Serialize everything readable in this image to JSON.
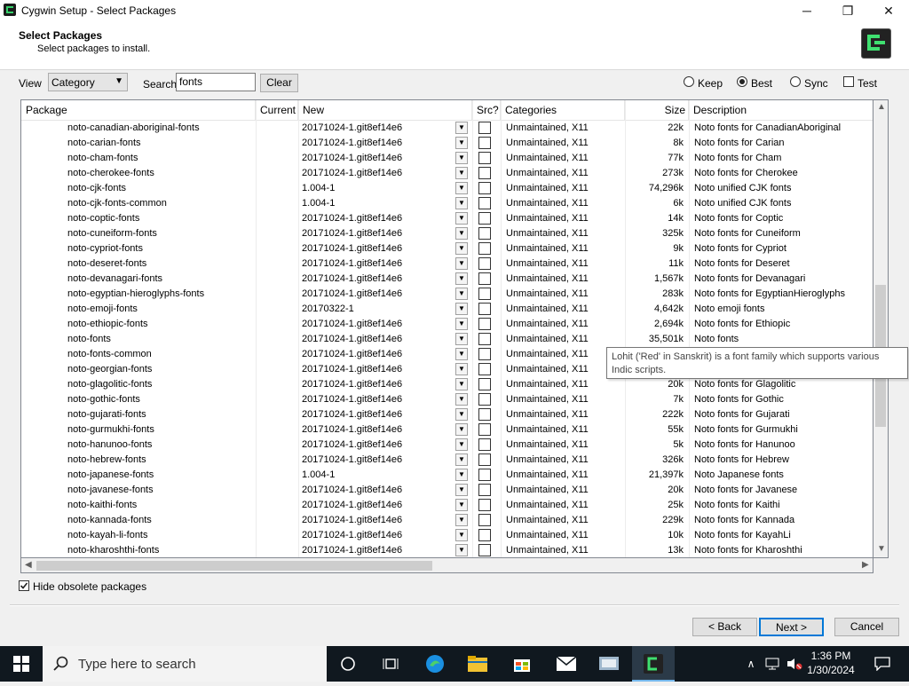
{
  "window": {
    "title": "Cygwin Setup - Select Packages",
    "minimize": "─",
    "maximize": "❐",
    "close": "✕"
  },
  "header": {
    "title": "Select Packages",
    "subtitle": "Select packages to install."
  },
  "toolbar": {
    "view_label": "View",
    "view_value": "Category",
    "search_label": "Search",
    "search_value": "fonts",
    "clear_label": "Clear",
    "radios": [
      {
        "label": "Keep",
        "selected": false
      },
      {
        "label": "Best",
        "selected": true
      },
      {
        "label": "Sync",
        "selected": false
      }
    ],
    "test_label": "Test"
  },
  "columns": [
    "Package",
    "Current",
    "New",
    "Src?",
    "Categories",
    "Size",
    "Description"
  ],
  "rows": [
    {
      "pkg": "noto-canadian-aboriginal-fonts",
      "new": "20171024-1.git8ef14e6",
      "cat": "Unmaintained, X11",
      "size": "22k",
      "desc": "Noto fonts for CanadianAboriginal"
    },
    {
      "pkg": "noto-carian-fonts",
      "new": "20171024-1.git8ef14e6",
      "cat": "Unmaintained, X11",
      "size": "8k",
      "desc": "Noto fonts for Carian"
    },
    {
      "pkg": "noto-cham-fonts",
      "new": "20171024-1.git8ef14e6",
      "cat": "Unmaintained, X11",
      "size": "77k",
      "desc": "Noto fonts for Cham"
    },
    {
      "pkg": "noto-cherokee-fonts",
      "new": "20171024-1.git8ef14e6",
      "cat": "Unmaintained, X11",
      "size": "273k",
      "desc": "Noto fonts for Cherokee"
    },
    {
      "pkg": "noto-cjk-fonts",
      "new": "1.004-1",
      "cat": "Unmaintained, X11",
      "size": "74,296k",
      "desc": "Noto unified CJK fonts"
    },
    {
      "pkg": "noto-cjk-fonts-common",
      "new": "1.004-1",
      "cat": "Unmaintained, X11",
      "size": "6k",
      "desc": "Noto unified CJK fonts"
    },
    {
      "pkg": "noto-coptic-fonts",
      "new": "20171024-1.git8ef14e6",
      "cat": "Unmaintained, X11",
      "size": "14k",
      "desc": "Noto fonts for Coptic"
    },
    {
      "pkg": "noto-cuneiform-fonts",
      "new": "20171024-1.git8ef14e6",
      "cat": "Unmaintained, X11",
      "size": "325k",
      "desc": "Noto fonts for Cuneiform"
    },
    {
      "pkg": "noto-cypriot-fonts",
      "new": "20171024-1.git8ef14e6",
      "cat": "Unmaintained, X11",
      "size": "9k",
      "desc": "Noto fonts for Cypriot"
    },
    {
      "pkg": "noto-deseret-fonts",
      "new": "20171024-1.git8ef14e6",
      "cat": "Unmaintained, X11",
      "size": "11k",
      "desc": "Noto fonts for Deseret"
    },
    {
      "pkg": "noto-devanagari-fonts",
      "new": "20171024-1.git8ef14e6",
      "cat": "Unmaintained, X11",
      "size": "1,567k",
      "desc": "Noto fonts for Devanagari"
    },
    {
      "pkg": "noto-egyptian-hieroglyphs-fonts",
      "new": "20171024-1.git8ef14e6",
      "cat": "Unmaintained, X11",
      "size": "283k",
      "desc": "Noto fonts for EgyptianHieroglyphs"
    },
    {
      "pkg": "noto-emoji-fonts",
      "new": "20170322-1",
      "cat": "Unmaintained, X11",
      "size": "4,642k",
      "desc": "Noto emoji fonts"
    },
    {
      "pkg": "noto-ethiopic-fonts",
      "new": "20171024-1.git8ef14e6",
      "cat": "Unmaintained, X11",
      "size": "2,694k",
      "desc": "Noto fonts for Ethiopic"
    },
    {
      "pkg": "noto-fonts",
      "new": "20171024-1.git8ef14e6",
      "cat": "Unmaintained, X11",
      "size": "35,501k",
      "desc": "Noto fonts"
    },
    {
      "pkg": "noto-fonts-common",
      "new": "20171024-1.git8ef14e6",
      "cat": "Unmaintained, X11",
      "size": "",
      "desc": ""
    },
    {
      "pkg": "noto-georgian-fonts",
      "new": "20171024-1.git8ef14e6",
      "cat": "Unmaintained, X11",
      "size": "",
      "desc": ""
    },
    {
      "pkg": "noto-glagolitic-fonts",
      "new": "20171024-1.git8ef14e6",
      "cat": "Unmaintained, X11",
      "size": "20k",
      "desc": "Noto fonts for Glagolitic"
    },
    {
      "pkg": "noto-gothic-fonts",
      "new": "20171024-1.git8ef14e6",
      "cat": "Unmaintained, X11",
      "size": "7k",
      "desc": "Noto fonts for Gothic"
    },
    {
      "pkg": "noto-gujarati-fonts",
      "new": "20171024-1.git8ef14e6",
      "cat": "Unmaintained, X11",
      "size": "222k",
      "desc": "Noto fonts for Gujarati"
    },
    {
      "pkg": "noto-gurmukhi-fonts",
      "new": "20171024-1.git8ef14e6",
      "cat": "Unmaintained, X11",
      "size": "55k",
      "desc": "Noto fonts for Gurmukhi"
    },
    {
      "pkg": "noto-hanunoo-fonts",
      "new": "20171024-1.git8ef14e6",
      "cat": "Unmaintained, X11",
      "size": "5k",
      "desc": "Noto fonts for Hanunoo"
    },
    {
      "pkg": "noto-hebrew-fonts",
      "new": "20171024-1.git8ef14e6",
      "cat": "Unmaintained, X11",
      "size": "326k",
      "desc": "Noto fonts for Hebrew"
    },
    {
      "pkg": "noto-japanese-fonts",
      "new": "1.004-1",
      "cat": "Unmaintained, X11",
      "size": "21,397k",
      "desc": "Noto Japanese fonts"
    },
    {
      "pkg": "noto-javanese-fonts",
      "new": "20171024-1.git8ef14e6",
      "cat": "Unmaintained, X11",
      "size": "20k",
      "desc": "Noto fonts for Javanese"
    },
    {
      "pkg": "noto-kaithi-fonts",
      "new": "20171024-1.git8ef14e6",
      "cat": "Unmaintained, X11",
      "size": "25k",
      "desc": "Noto fonts for Kaithi"
    },
    {
      "pkg": "noto-kannada-fonts",
      "new": "20171024-1.git8ef14e6",
      "cat": "Unmaintained, X11",
      "size": "229k",
      "desc": "Noto fonts for Kannada"
    },
    {
      "pkg": "noto-kayah-li-fonts",
      "new": "20171024-1.git8ef14e6",
      "cat": "Unmaintained, X11",
      "size": "10k",
      "desc": "Noto fonts for KayahLi"
    },
    {
      "pkg": "noto-kharoshthi-fonts",
      "new": "20171024-1.git8ef14e6",
      "cat": "Unmaintained, X11",
      "size": "13k",
      "desc": "Noto fonts for Kharoshthi"
    }
  ],
  "tooltip": {
    "line1": "Lohit ('Red' in Sanskrit) is a font family which supports various",
    "line2": "Indic scripts."
  },
  "footer": {
    "hide_obsolete_label": "Hide obsolete packages",
    "back_label": "< Back",
    "next_label": "Next >",
    "cancel_label": "Cancel"
  },
  "taskbar": {
    "search_placeholder": "Type here to search",
    "time": "1:36 PM",
    "date": "1/30/2024"
  }
}
